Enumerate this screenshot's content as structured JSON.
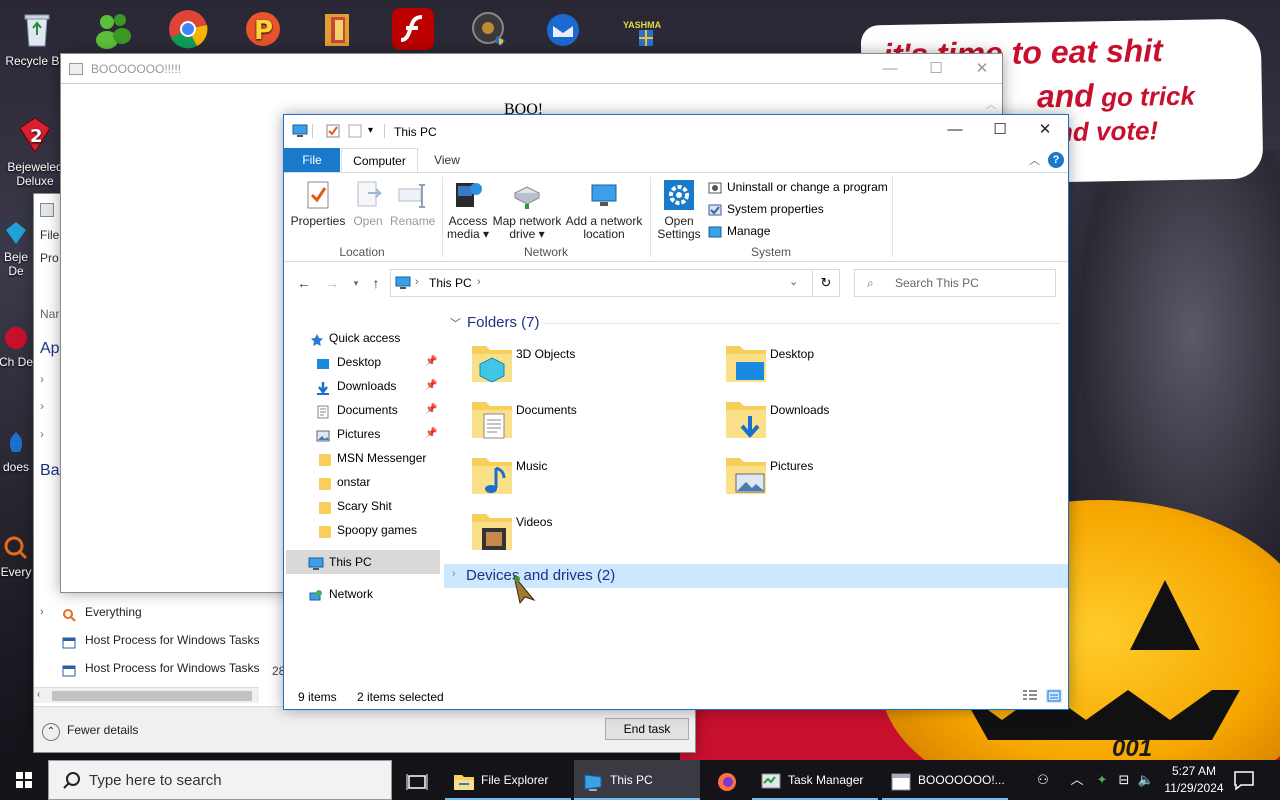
{
  "desktop": {
    "meme_caption": {
      "line1": "it's time to eat shit",
      "line2a": "and",
      "line2b": " go trick",
      "line3": "and vote!"
    },
    "pumpkin_number": "001",
    "icons": [
      {
        "label": "Recycle Bin"
      },
      {
        "label": "Bejeweled Deluxe"
      },
      {
        "label": "Beje De"
      },
      {
        "label": "Ch De"
      },
      {
        "label": "does"
      },
      {
        "label": "Every"
      }
    ],
    "top_icons": [
      "msn-icon",
      "chrome-icon",
      "pacman-icon",
      "folder-icon",
      "flash-icon",
      "vault-icon",
      "thunderbird-icon",
      "yashma-icon"
    ],
    "yashma_label": "YASHMA"
  },
  "boo_window": {
    "title": "BOOOOOOO!!!!!",
    "body": "BOO!"
  },
  "task_manager": {
    "sidebar_labels": [
      "File",
      "Pro",
      "Nar",
      "Ap",
      "Ba"
    ],
    "rows": [
      {
        "label": "Everything"
      },
      {
        "label": "Host Process for Windows Tasks"
      },
      {
        "label": "Host Process for Windows Tasks"
      }
    ],
    "partial_value": "28",
    "fewer_details": "Fewer details",
    "end_task": "End task"
  },
  "explorer": {
    "title": "This PC",
    "tabs": {
      "file": "File",
      "computer": "Computer",
      "view": "View"
    },
    "ribbon": {
      "location": {
        "label": "Location",
        "properties": "Properties",
        "open": "Open",
        "rename": "Rename"
      },
      "network": {
        "label": "Network",
        "access_media_1": "Access",
        "access_media_2": "media ▾",
        "map_drive_1": "Map network",
        "map_drive_2": "drive ▾",
        "add_location_1": "Add a network",
        "add_location_2": "location"
      },
      "system": {
        "label": "System",
        "open_settings_1": "Open",
        "open_settings_2": "Settings",
        "uninstall": "Uninstall or change a program",
        "system_properties": "System properties",
        "manage": "Manage"
      }
    },
    "address": {
      "crumb": "This PC"
    },
    "search_placeholder": "Search This PC",
    "nav": {
      "quick_access": "Quick access",
      "items": [
        {
          "label": "Desktop",
          "pinned": true
        },
        {
          "label": "Downloads",
          "pinned": true
        },
        {
          "label": "Documents",
          "pinned": true
        },
        {
          "label": "Pictures",
          "pinned": true
        },
        {
          "label": "MSN Messenger",
          "pinned": false
        },
        {
          "label": "onstar",
          "pinned": false
        },
        {
          "label": "Scary Shit",
          "pinned": false
        },
        {
          "label": "Spoopy games",
          "pinned": false
        }
      ],
      "this_pc": "This PC",
      "network": "Network"
    },
    "folders_header": "Folders (7)",
    "folders": [
      "3D Objects",
      "Desktop",
      "Documents",
      "Downloads",
      "Music",
      "Pictures",
      "Videos"
    ],
    "devices_header": "Devices and drives (2)",
    "status": {
      "items": "9 items",
      "selected": "2 items selected"
    }
  },
  "taskbar": {
    "search_placeholder": "Type here to search",
    "apps": [
      {
        "label": "File Explorer"
      },
      {
        "label": "This PC"
      },
      {
        "label": "Task Manager"
      },
      {
        "label": "BOOOOOOO!..."
      }
    ],
    "time": "5:27 AM",
    "date": "11/29/2024"
  },
  "colors": {
    "accent": "#1979ca",
    "selection": "#cce8ff",
    "folder_yellow": "#f6cf5c",
    "meme_red": "#c8102e",
    "pumpkin": "#f6a600"
  }
}
